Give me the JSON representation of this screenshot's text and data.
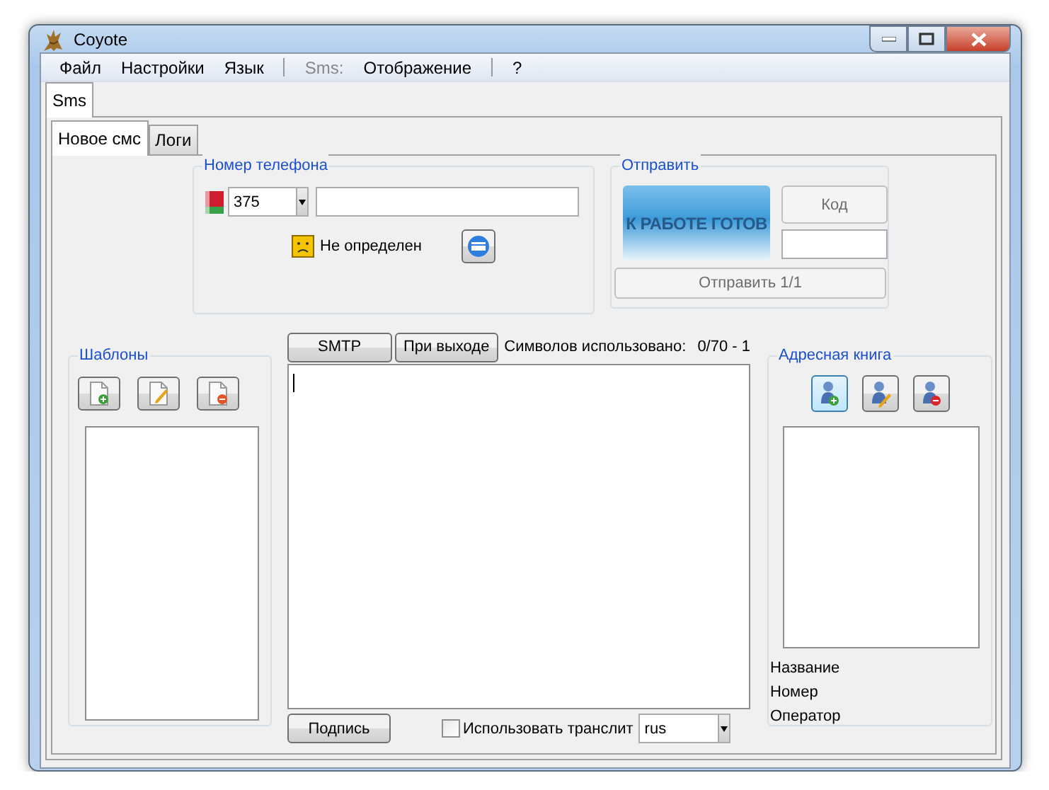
{
  "window": {
    "title": "Coyote"
  },
  "menu": [
    {
      "kind": "item",
      "label": "Файл",
      "disabled": false
    },
    {
      "kind": "item",
      "label": "Настройки",
      "disabled": false
    },
    {
      "kind": "item",
      "label": "Язык",
      "disabled": false
    },
    {
      "kind": "separator"
    },
    {
      "kind": "item",
      "label": "Sms:",
      "disabled": true
    },
    {
      "kind": "item",
      "label": "Отображение",
      "disabled": false
    },
    {
      "kind": "separator"
    },
    {
      "kind": "item",
      "label": "?",
      "disabled": false
    }
  ],
  "outer_tabs": [
    {
      "label": "Sms",
      "selected": true
    }
  ],
  "inner_tabs": [
    {
      "label": "Новое смс",
      "selected": true
    },
    {
      "label": "Логи",
      "selected": false
    }
  ],
  "phone_group": {
    "title": "Номер телефона",
    "country_code": "375",
    "status": "Не определен"
  },
  "send_group": {
    "title": "Отправить",
    "banner": "К РАБОТЕ ГОТОВ",
    "code_button": {
      "label": "Код",
      "disabled": true
    },
    "send_button": {
      "label": "Отправить 1/1",
      "disabled": true
    }
  },
  "templates": {
    "title": "Шаблоны"
  },
  "editor": {
    "buttons": [
      "SMTP",
      "При выходе"
    ],
    "counter_label": "Символов использовано:",
    "counter": "0/70 - 1",
    "signature_button": "Подпись",
    "translit": {
      "label": "Использовать транслит",
      "checked": false
    },
    "language": "rus"
  },
  "address_book": {
    "title": "Адресная книга",
    "fields": [
      "Название",
      "Номер",
      "Оператор"
    ]
  }
}
